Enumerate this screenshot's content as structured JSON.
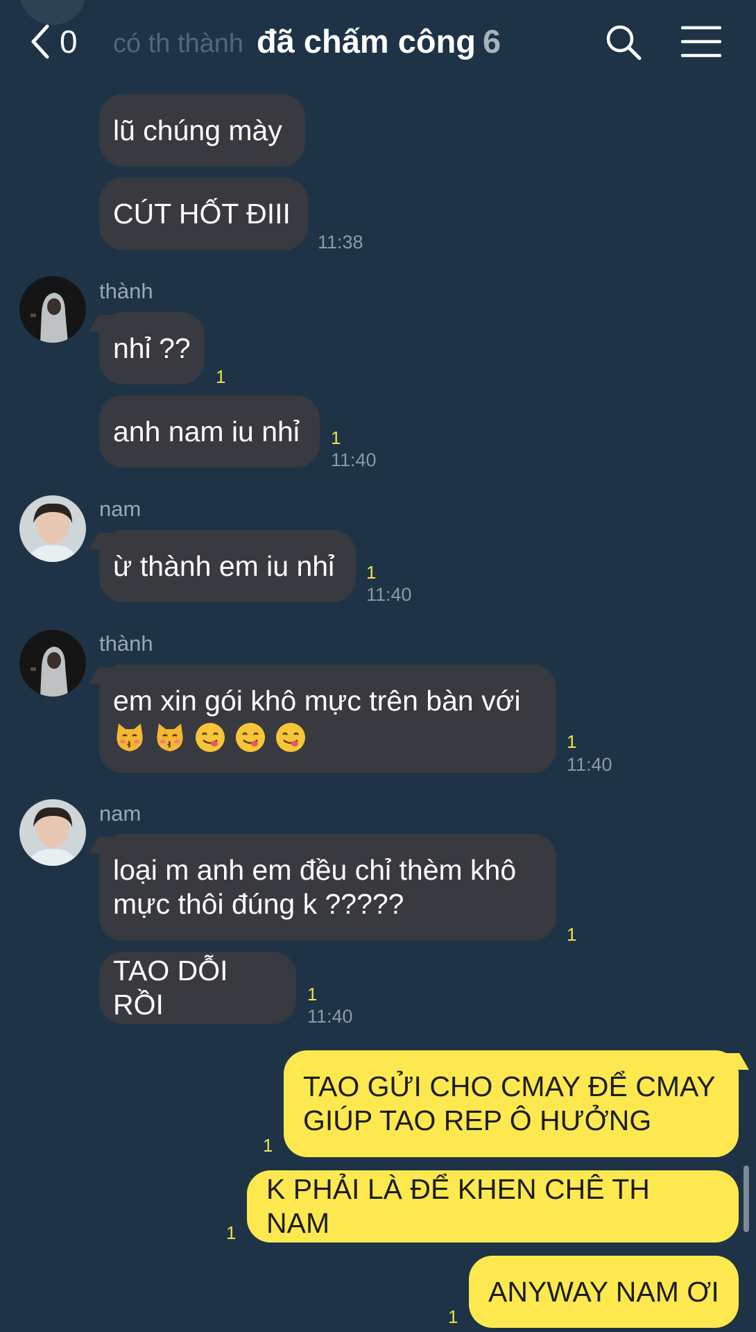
{
  "header": {
    "back_count": "0",
    "title": "đã chấm công",
    "member_count": "6",
    "ghost_text": "có th thành"
  },
  "messages": [
    {
      "sender": "",
      "text": "lũ chúng mày"
    },
    {
      "sender": "",
      "text": "CÚT HỐT ĐIII",
      "time": "11:38"
    },
    {
      "sender": "thành",
      "text": "nhỉ ??",
      "read": "1"
    },
    {
      "sender": "",
      "text": "anh nam iu nhỉ",
      "read": "1",
      "time": "11:40"
    },
    {
      "sender": "nam",
      "text": "ừ thành em iu nhỉ",
      "read": "1",
      "time": "11:40"
    },
    {
      "sender": "thành",
      "text": "em xin gói khô mực trên bàn với",
      "emojis": [
        "kissing-cat-emoji",
        "kissing-cat-emoji",
        "yum-emoji",
        "yum-emoji",
        "yum-emoji"
      ],
      "read": "1",
      "time": "11:40"
    },
    {
      "sender": "nam",
      "text_lines": [
        "loại m anh em đều chỉ thèm khô",
        "mực thôi đúng k ?????"
      ],
      "read": "1"
    },
    {
      "sender": "",
      "text": "TAO DỖI RỒI",
      "read": "1",
      "time": "11:40"
    }
  ],
  "my_messages": [
    {
      "text_lines": [
        "TAO GỬI CHO CMAY ĐỂ CMAY",
        "GIÚP TAO REP Ô HƯỞNG"
      ],
      "read": "1"
    },
    {
      "text": "K PHẢI LÀ ĐỂ KHEN CHÊ TH NAM",
      "read": "1"
    },
    {
      "text": "ANYWAY NAM ƠI",
      "read": "1"
    }
  ],
  "colors": {
    "background": "#1e3346",
    "incoming_bubble": "#383a3f",
    "outgoing_bubble": "#fde94f",
    "read_count": "#f1e04c"
  }
}
